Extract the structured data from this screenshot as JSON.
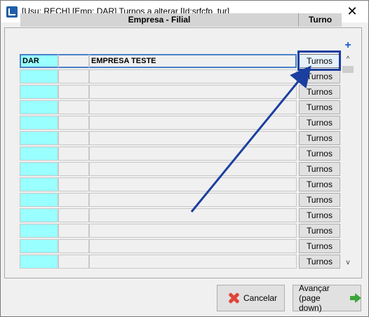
{
  "window": {
    "title": "[Usu: RECH] [Emp: DAR] Turnos a alterar [Id:srfcfp_tur]",
    "close_symbol": "✕"
  },
  "grid": {
    "headers": {
      "empresa_filial": "Empresa - Filial",
      "turno": "Turno"
    },
    "rows": [
      {
        "empresa": "DAR",
        "filial": "",
        "nome": "EMPRESA TESTE",
        "turno_button": "Turnos"
      },
      {
        "empresa": "",
        "filial": "",
        "nome": "",
        "turno_button": "Turnos"
      },
      {
        "empresa": "",
        "filial": "",
        "nome": "",
        "turno_button": "Turnos"
      },
      {
        "empresa": "",
        "filial": "",
        "nome": "",
        "turno_button": "Turnos"
      },
      {
        "empresa": "",
        "filial": "",
        "nome": "",
        "turno_button": "Turnos"
      },
      {
        "empresa": "",
        "filial": "",
        "nome": "",
        "turno_button": "Turnos"
      },
      {
        "empresa": "",
        "filial": "",
        "nome": "",
        "turno_button": "Turnos"
      },
      {
        "empresa": "",
        "filial": "",
        "nome": "",
        "turno_button": "Turnos"
      },
      {
        "empresa": "",
        "filial": "",
        "nome": "",
        "turno_button": "Turnos"
      },
      {
        "empresa": "",
        "filial": "",
        "nome": "",
        "turno_button": "Turnos"
      },
      {
        "empresa": "",
        "filial": "",
        "nome": "",
        "turno_button": "Turnos"
      },
      {
        "empresa": "",
        "filial": "",
        "nome": "",
        "turno_button": "Turnos"
      },
      {
        "empresa": "",
        "filial": "",
        "nome": "",
        "turno_button": "Turnos"
      },
      {
        "empresa": "",
        "filial": "",
        "nome": "",
        "turno_button": "Turnos"
      }
    ],
    "add_symbol": "+",
    "scroll_up_symbol": "^",
    "scroll_down_symbol": "v"
  },
  "footer": {
    "cancel_label": "Cancelar",
    "next_label_line1": "Avançar",
    "next_label_line2": "(page down)"
  },
  "icons": {
    "app": "app-icon",
    "close": "close-icon",
    "add": "plus-icon",
    "cancel": "red-x-icon",
    "next": "green-arrow-right-icon"
  },
  "colors": {
    "code_cell": "#99ffff",
    "annotation": "#1a3fa0",
    "header_bg": "#d4d4d4"
  }
}
